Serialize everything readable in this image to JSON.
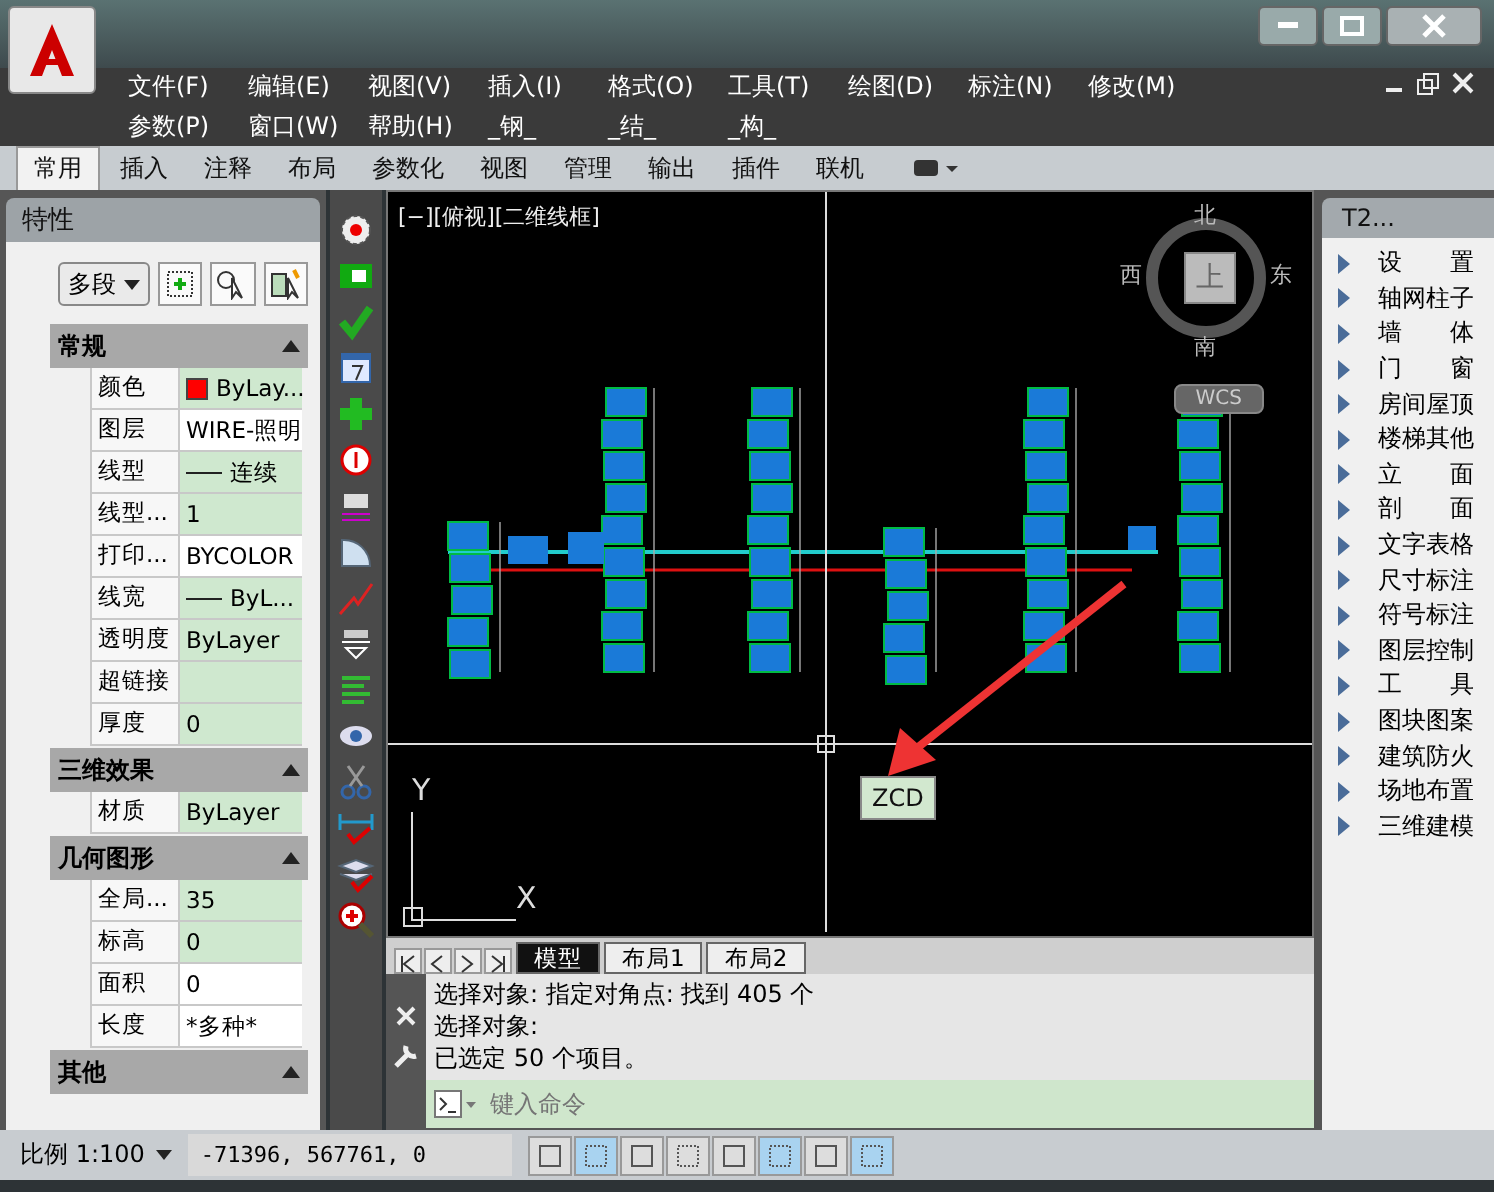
{
  "menu_bar": {
    "items": [
      "文件(F)",
      "编辑(E)",
      "视图(V)",
      "插入(I)",
      "格式(O)",
      "工具(T)",
      "绘图(D)",
      "标注(N)",
      "修改(M)",
      "参数(P)",
      "窗口(W)",
      "帮助(H)",
      "_钢_",
      "_结_",
      "_构_"
    ]
  },
  "ribbon_tabs": [
    {
      "label": "常用",
      "selected": true
    },
    {
      "label": "插入",
      "selected": false
    },
    {
      "label": "注释",
      "selected": false
    },
    {
      "label": "布局",
      "selected": false
    },
    {
      "label": "参数化",
      "selected": false
    },
    {
      "label": "视图",
      "selected": false
    },
    {
      "label": "管理",
      "selected": false
    },
    {
      "label": "输出",
      "selected": false
    },
    {
      "label": "插件",
      "selected": false
    },
    {
      "label": "联机",
      "selected": false
    }
  ],
  "properties": {
    "title": "特性",
    "object_type": "多段",
    "sections": [
      {
        "title": "常规",
        "expanded": true,
        "rows": [
          {
            "label": "颜色",
            "value": "ByLay...",
            "kind": "color",
            "color": "#ff0000",
            "highlighted": true
          },
          {
            "label": "图层",
            "value": "WIRE-照明",
            "kind": "text",
            "highlighted": false
          },
          {
            "label": "线型",
            "value": "连续",
            "kind": "line",
            "highlighted": true
          },
          {
            "label": "线型...",
            "value": "1",
            "kind": "text",
            "highlighted": true
          },
          {
            "label": "打印...",
            "value": "BYCOLOR",
            "kind": "text",
            "highlighted": false
          },
          {
            "label": "线宽",
            "value": "ByL...",
            "kind": "line",
            "highlighted": true
          },
          {
            "label": "透明度",
            "value": "ByLayer",
            "kind": "text",
            "highlighted": true
          },
          {
            "label": "超链接",
            "kind": "text",
            "highlighted": true
          },
          {
            "label": "厚度",
            "value": "0",
            "kind": "text",
            "highlighted": true
          }
        ]
      },
      {
        "title": "三维效果",
        "expanded": true,
        "rows": [
          {
            "label": "材质",
            "value": "ByLayer",
            "kind": "text",
            "highlighted": true
          }
        ]
      },
      {
        "title": "几何图形",
        "expanded": true,
        "rows": [
          {
            "label": "全局...",
            "value": "35",
            "kind": "text",
            "highlighted": true
          },
          {
            "label": "标高",
            "value": "0",
            "kind": "text",
            "highlighted": true
          },
          {
            "label": "面积",
            "value": "0",
            "kind": "text",
            "highlighted": false
          },
          {
            "label": "长度",
            "value": "*多种*",
            "kind": "text",
            "highlighted": false
          }
        ]
      },
      {
        "title": "其他",
        "expanded": true
      }
    ]
  },
  "viewport": {
    "label": "[−][俯视][二维线框]",
    "compass": {
      "north": "北",
      "south": "南",
      "west": "西",
      "east": "东",
      "face": "上"
    },
    "ucs_button": "WCS",
    "axis_x": "X",
    "axis_y": "Y",
    "tooltip": "ZCD"
  },
  "layout_tabs": [
    {
      "label": "模型",
      "selected": true
    },
    {
      "label": "布局1",
      "selected": false
    },
    {
      "label": "布局2",
      "selected": false
    }
  ],
  "command_line": {
    "history": [
      "选择对象: 指定对角点: 找到 405 个",
      "选择对象:",
      "已选定 50 个项目。"
    ],
    "placeholder": "键入命令"
  },
  "tool_palette": {
    "title": "T2...",
    "items": [
      "设　　置",
      "轴网柱子",
      "墙　　体",
      "门　　窗",
      "房间屋顶",
      "楼梯其他",
      "立　　面",
      "剖　　面",
      "文字表格",
      "尺寸标注",
      "符号标注",
      "图层控制",
      "工　　具",
      "图块图案",
      "建筑防火",
      "场地布置",
      "三维建模"
    ]
  },
  "status_bar": {
    "scale": "比例 1:100",
    "coordinates": "-71396, 567761, 0",
    "toggles": [
      {
        "on": false
      },
      {
        "on": true
      },
      {
        "on": false
      },
      {
        "on": false
      },
      {
        "on": false
      },
      {
        "on": true
      },
      {
        "on": false
      },
      {
        "on": true
      }
    ]
  }
}
